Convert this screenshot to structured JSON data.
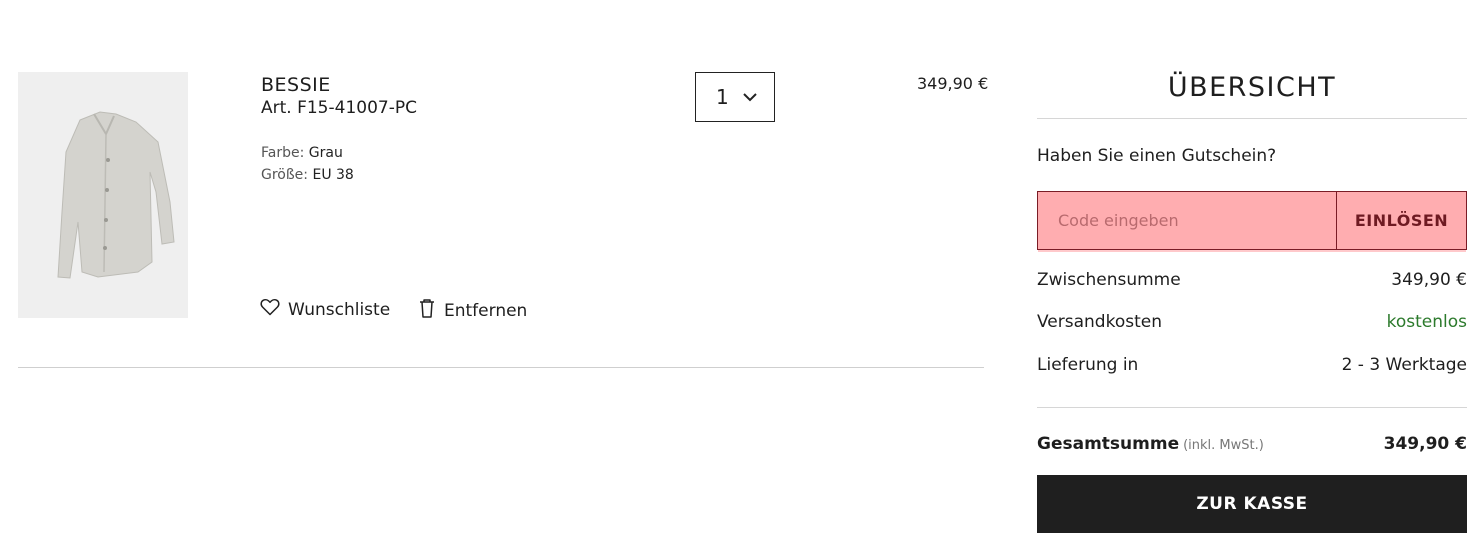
{
  "cart": {
    "item": {
      "name": "BESSIE",
      "sku": "Art. F15-41007-PC",
      "color_label": "Farbe:",
      "color_value": "Grau",
      "size_label": "Größe:",
      "size_value": "EU 38",
      "quantity": "1",
      "price": "349,90 €",
      "wishlist_label": "Wunschliste",
      "remove_label": "Entfernen"
    }
  },
  "summary": {
    "title": "ÜBERSICHT",
    "voucher_question": "Haben Sie einen Gutschein?",
    "voucher_placeholder": "Code eingeben",
    "voucher_button": "EINLÖSEN",
    "subtotal_label": "Zwischensumme",
    "subtotal_value": "349,90 €",
    "shipping_label": "Versandkosten",
    "shipping_value": "kostenlos",
    "delivery_label": "Lieferung in",
    "delivery_value": "2 - 3 Werktage",
    "total_label": "Gesamtsumme",
    "total_note": "(inkl. MwSt.)",
    "total_value": "349,90 €",
    "checkout_button": "ZUR KASSE"
  },
  "colors": {
    "voucher_highlight": "#ffadb0",
    "voucher_border": "#7a1c26",
    "free_shipping": "#2c7a2c",
    "checkout_bg": "#1f1f1f"
  },
  "icons": {
    "quantity_dropdown": "chevron-down-icon",
    "wishlist": "heart-icon",
    "remove": "trash-icon"
  }
}
